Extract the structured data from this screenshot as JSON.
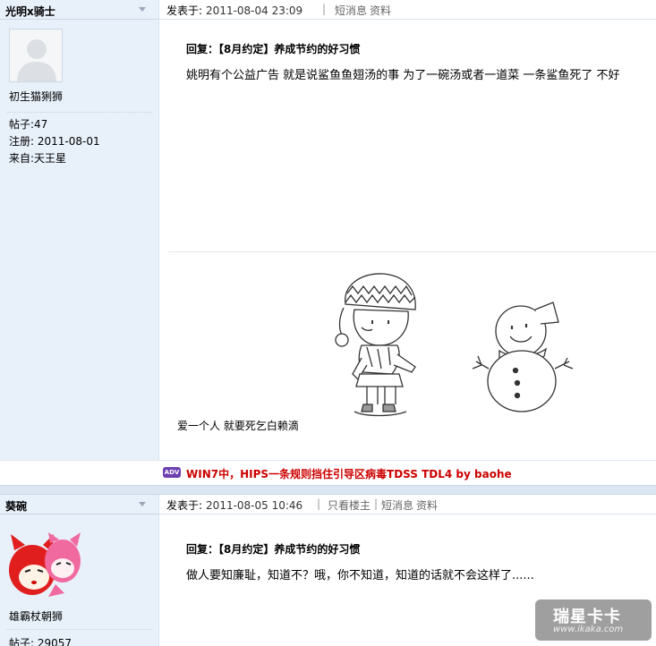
{
  "post1": {
    "username": "光明x骑士",
    "rank": "初生猫猁狮",
    "stats": {
      "posts_label": "帖子:",
      "posts_value": "47",
      "registered_label": "注册:",
      "registered_value": "2011-08-01",
      "from_label": "来自:",
      "from_value": "天王星"
    },
    "posted_label": "发表于:",
    "posted_date": "2011-08-04 23:09",
    "links": [
      "短消息",
      "资料"
    ],
    "reply_title": "回复：【8月约定】养成节约的好习惯",
    "body": "姚明有个公益广告 就是说鲨鱼鱼翅汤的事 为了一碗汤或者一道菜 一条鲨鱼死了 不好",
    "image_caption": "爱一个人 就要死乞白赖滴",
    "signature": {
      "badge": "ADV",
      "text": "WIN7中，HIPS一条规则挡住引导区病毒TDSS TDL4 by baohe"
    }
  },
  "post2": {
    "username": "葵碗",
    "rank": "雄霸杖朝狮",
    "stats": {
      "posts_label": "帖子:",
      "posts_value": "29057"
    },
    "posted_label": "发表于:",
    "posted_date": "2011-08-05 10:46",
    "links": [
      "只看楼主",
      "短消息",
      "资料"
    ],
    "reply_title": "回复：【8月约定】养成节约的好习惯",
    "body": "做人要知廉耻，知道不？哦，你不知道，知道的话就不会这样了......"
  },
  "watermark": {
    "main": "瑞星卡卡",
    "sub": "www.ikaka.com"
  },
  "colors": {
    "sidebar_bg": "#e8f0fa",
    "signature_red": "#cc0000",
    "adv_badge": "#6b3fb0"
  }
}
